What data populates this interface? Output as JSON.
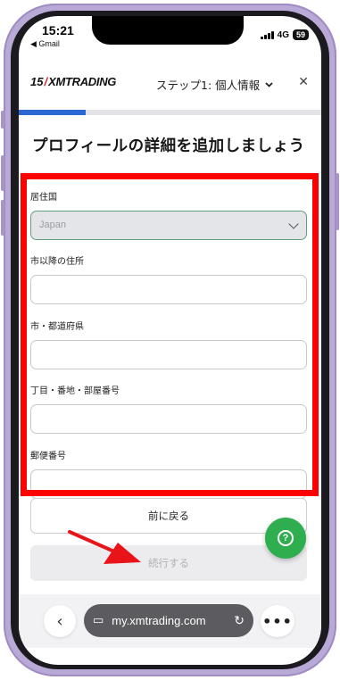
{
  "status_bar": {
    "time": "15:21",
    "back_app": "◀ Gmail",
    "network": "4G",
    "battery": "59"
  },
  "header": {
    "logo_number": "15",
    "logo_text": "XMTRADING",
    "step_title": "ステップ1: 個人情報",
    "close_symbol": "✕"
  },
  "progress": {
    "value_fraction": 0.22
  },
  "page_title": "プロフィールの詳細を追加しましょう",
  "form": {
    "country_label": "居住国",
    "country_value": "Japan",
    "address_label": "市以降の住所",
    "prefecture_label": "市・都道府県",
    "street_label": "丁目・番地・部屋番号",
    "postal_label": "郵便番号"
  },
  "buttons": {
    "back_label": "前に戻る",
    "continue_label": "続行する"
  },
  "browser": {
    "url": "my.xmtrading.com"
  },
  "colors": {
    "highlight": "#ff0000",
    "accent": "#2b67d3",
    "help_fab": "#2eae4e"
  }
}
